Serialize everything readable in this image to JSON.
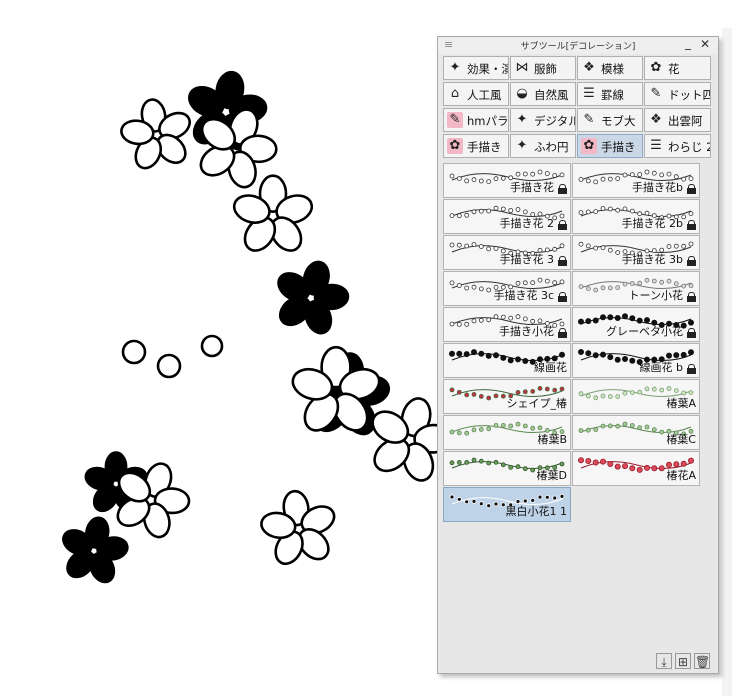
{
  "panel": {
    "title": "サブツール[デコレーション]",
    "menu_icon": "≡",
    "minimize_icon": "_",
    "close_icon": "✕"
  },
  "groups": [
    {
      "label": "効果・演",
      "icon": "sparkle-icon",
      "glyph": "✦",
      "selected": false
    },
    {
      "label": "服飾",
      "icon": "bow-icon",
      "glyph": "⋈",
      "selected": false
    },
    {
      "label": "模様",
      "icon": "pattern-icon",
      "glyph": "❖",
      "selected": false
    },
    {
      "label": "花",
      "icon": "flower-icon",
      "glyph": "✿",
      "selected": false
    },
    {
      "label": "人工風",
      "icon": "house-icon",
      "glyph": "⌂",
      "selected": false
    },
    {
      "label": "自然風",
      "icon": "rock-icon",
      "glyph": "◒",
      "selected": false
    },
    {
      "label": "罫線",
      "icon": "lines-icon",
      "glyph": "☰",
      "selected": false
    },
    {
      "label": "ドット四",
      "icon": "pen-icon",
      "glyph": "✎",
      "selected": false
    },
    {
      "label": "hmパラ",
      "icon": "brush-pink-icon",
      "glyph": "✎",
      "selected": false,
      "pink": true
    },
    {
      "label": "デジタル",
      "icon": "sparkle-icon",
      "glyph": "✦",
      "selected": false
    },
    {
      "label": "モブ大",
      "icon": "pen-icon",
      "glyph": "✎",
      "selected": false
    },
    {
      "label": "出雲阿",
      "icon": "pattern-icon",
      "glyph": "❖",
      "selected": false
    },
    {
      "label": "手描き",
      "icon": "flower-pink-icon",
      "glyph": "✿",
      "selected": false,
      "pink": true
    },
    {
      "label": "ふわ円",
      "icon": "sparkle-icon",
      "glyph": "✦",
      "selected": false
    },
    {
      "label": "手描き",
      "icon": "flower-pink-icon",
      "glyph": "✿",
      "selected": true,
      "pink": true
    },
    {
      "label": "わらじ 2",
      "icon": "lines-icon",
      "glyph": "☰",
      "selected": false
    }
  ],
  "items": [
    {
      "name": "手描き花",
      "locked": true,
      "style": "white",
      "selected": false
    },
    {
      "name": "手描き花b",
      "locked": true,
      "style": "white",
      "selected": false
    },
    {
      "name": "手描き花 2",
      "locked": true,
      "style": "white",
      "selected": false
    },
    {
      "name": "手描き花 2b",
      "locked": true,
      "style": "white",
      "selected": false
    },
    {
      "name": "手描き花 3",
      "locked": true,
      "style": "white",
      "selected": false
    },
    {
      "name": "手描き花 3b",
      "locked": true,
      "style": "white",
      "selected": false
    },
    {
      "name": "手描き花 3c",
      "locked": true,
      "style": "white",
      "selected": false
    },
    {
      "name": "トーン小花",
      "locked": true,
      "style": "gray",
      "selected": false
    },
    {
      "name": "手描き小花",
      "locked": true,
      "style": "white",
      "selected": false
    },
    {
      "name": "グレーベタ小花",
      "locked": true,
      "style": "black",
      "selected": false
    },
    {
      "name": "線画花",
      "locked": false,
      "style": "black",
      "selected": false
    },
    {
      "name": "線画花 b",
      "locked": true,
      "style": "black",
      "selected": false
    },
    {
      "name": "シェイプ_椿",
      "locked": false,
      "style": "red",
      "selected": false
    },
    {
      "name": "椿葉A",
      "locked": false,
      "style": "lightgreen",
      "selected": false
    },
    {
      "name": "椿葉B",
      "locked": false,
      "style": "green",
      "selected": false
    },
    {
      "name": "椿葉C",
      "locked": false,
      "style": "green",
      "selected": false
    },
    {
      "name": "椿葉D",
      "locked": false,
      "style": "darkgreen",
      "selected": false
    },
    {
      "name": "椿花A",
      "locked": false,
      "style": "pinkred",
      "selected": false
    },
    {
      "name": "黒白小花1 1",
      "locked": false,
      "style": "mixed",
      "selected": true
    }
  ],
  "bottom_icons": [
    "download-icon",
    "add-icon",
    "trash-icon"
  ],
  "colors": {
    "selection": "#bfd3e8",
    "panel_bg": "#e7e7e7"
  }
}
